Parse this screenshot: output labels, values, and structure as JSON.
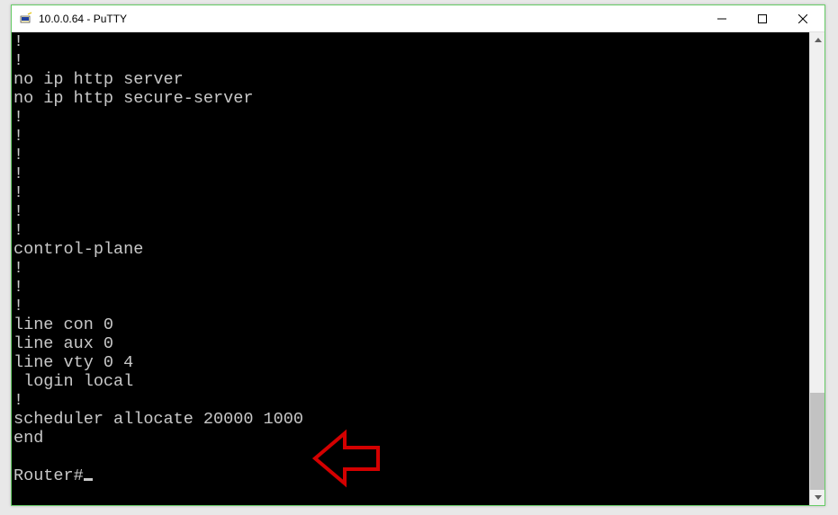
{
  "window": {
    "title": "10.0.0.64 - PuTTY"
  },
  "terminal": {
    "lines": [
      "!",
      "!",
      "no ip http server",
      "no ip http secure-server",
      "!",
      "!",
      "!",
      "!",
      "!",
      "!",
      "!",
      "control-plane",
      "!",
      "!",
      "!",
      "line con 0",
      "line aux 0",
      "line vty 0 4",
      " login local",
      "!",
      "scheduler allocate 20000 1000",
      "end",
      "",
      "Router#"
    ],
    "prompt_cursor": true
  },
  "scrollbar": {
    "thumb_top_pct": 78,
    "thumb_height_pct": 22
  },
  "annotation": {
    "color": "#d40000"
  }
}
